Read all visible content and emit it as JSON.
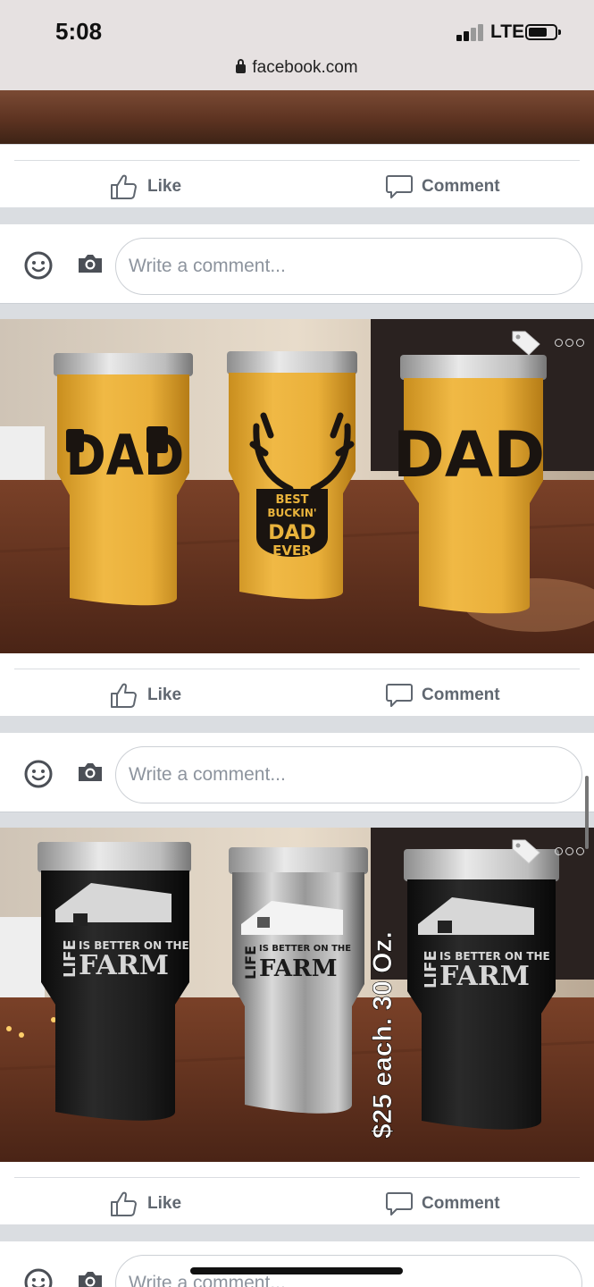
{
  "status": {
    "time": "5:08",
    "network": "LTE",
    "url": "facebook.com"
  },
  "actions": {
    "like_label": "Like",
    "comment_label": "Comment"
  },
  "comment_box": {
    "placeholder": "Write a comment..."
  },
  "posts": [
    {
      "tumbler_texts": [
        "DAD",
        "BEST",
        "BUCKIN'",
        "DAD",
        "EVER",
        "DAD"
      ],
      "tumbler_color": "#e9b33c"
    },
    {
      "tumbler_texts": [
        "LIFE",
        "IS BETTER ON THE",
        "FARM"
      ],
      "overlay_text": "$25 each. 30 Oz."
    }
  ],
  "icons": [
    "lock-icon",
    "like-icon",
    "comment-icon",
    "smiley-icon",
    "camera-icon",
    "tag-icon",
    "more-icon"
  ],
  "colors": {
    "action_gray": "#606770",
    "placeholder_gray": "#8d949e",
    "divider": "#dadde1"
  }
}
